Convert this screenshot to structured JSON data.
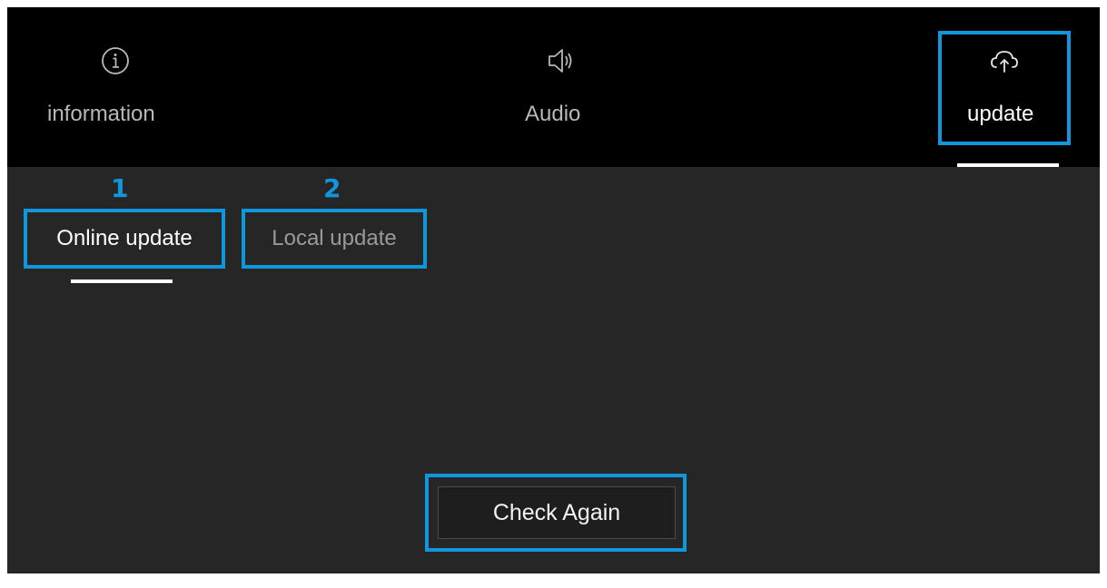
{
  "topbar": {
    "tabs": [
      {
        "label": "information",
        "icon": "info-circle-icon"
      },
      {
        "label": "Audio",
        "icon": "speaker-icon"
      },
      {
        "label": "update",
        "icon": "cloud-upload-icon"
      }
    ],
    "active_tab": "update"
  },
  "update_page": {
    "step_numbers": [
      "1",
      "2"
    ],
    "subtabs": [
      {
        "label": "Online update",
        "selected": true
      },
      {
        "label": "Local update",
        "selected": false
      }
    ],
    "check_button_label": "Check Again"
  },
  "colors": {
    "highlight": "#1296db",
    "topbar_bg": "#000000",
    "content_bg": "#262626",
    "active_text": "#ffffff",
    "inactive_text": "#9a9a9a"
  }
}
